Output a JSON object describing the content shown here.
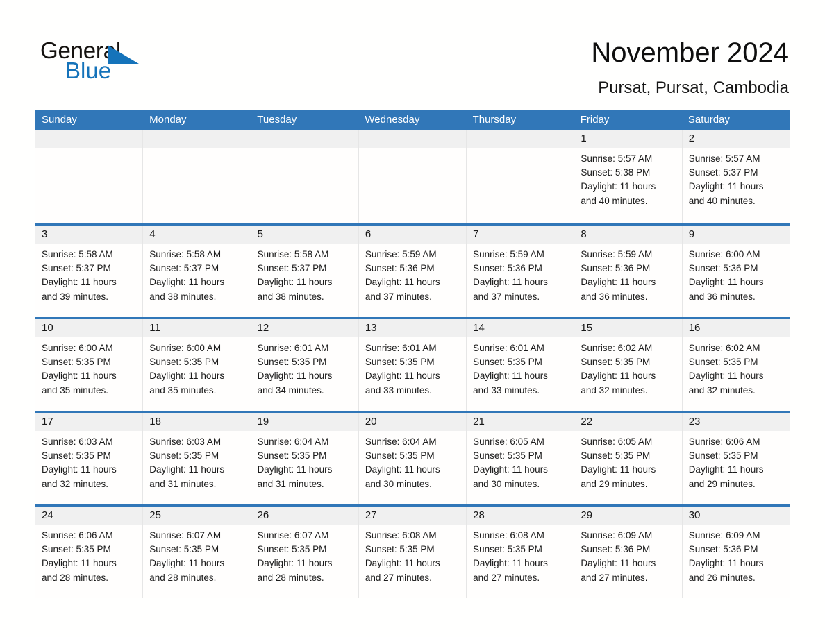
{
  "brand": {
    "name_part1": "General",
    "name_part2": "Blue",
    "accent_color": "#1573ba"
  },
  "header": {
    "title": "November 2024",
    "subtitle": "Pursat, Pursat, Cambodia"
  },
  "calendar": {
    "header_color": "#3177b8",
    "daynum_band_color": "#f0f0f0",
    "weekday_headers": [
      "Sunday",
      "Monday",
      "Tuesday",
      "Wednesday",
      "Thursday",
      "Friday",
      "Saturday"
    ],
    "weeks": [
      [
        {
          "day": "",
          "lines": []
        },
        {
          "day": "",
          "lines": []
        },
        {
          "day": "",
          "lines": []
        },
        {
          "day": "",
          "lines": []
        },
        {
          "day": "",
          "lines": []
        },
        {
          "day": "1",
          "lines": [
            "Sunrise: 5:57 AM",
            "Sunset: 5:38 PM",
            "Daylight: 11 hours",
            "and 40 minutes."
          ]
        },
        {
          "day": "2",
          "lines": [
            "Sunrise: 5:57 AM",
            "Sunset: 5:37 PM",
            "Daylight: 11 hours",
            "and 40 minutes."
          ]
        }
      ],
      [
        {
          "day": "3",
          "lines": [
            "Sunrise: 5:58 AM",
            "Sunset: 5:37 PM",
            "Daylight: 11 hours",
            "and 39 minutes."
          ]
        },
        {
          "day": "4",
          "lines": [
            "Sunrise: 5:58 AM",
            "Sunset: 5:37 PM",
            "Daylight: 11 hours",
            "and 38 minutes."
          ]
        },
        {
          "day": "5",
          "lines": [
            "Sunrise: 5:58 AM",
            "Sunset: 5:37 PM",
            "Daylight: 11 hours",
            "and 38 minutes."
          ]
        },
        {
          "day": "6",
          "lines": [
            "Sunrise: 5:59 AM",
            "Sunset: 5:36 PM",
            "Daylight: 11 hours",
            "and 37 minutes."
          ]
        },
        {
          "day": "7",
          "lines": [
            "Sunrise: 5:59 AM",
            "Sunset: 5:36 PM",
            "Daylight: 11 hours",
            "and 37 minutes."
          ]
        },
        {
          "day": "8",
          "lines": [
            "Sunrise: 5:59 AM",
            "Sunset: 5:36 PM",
            "Daylight: 11 hours",
            "and 36 minutes."
          ]
        },
        {
          "day": "9",
          "lines": [
            "Sunrise: 6:00 AM",
            "Sunset: 5:36 PM",
            "Daylight: 11 hours",
            "and 36 minutes."
          ]
        }
      ],
      [
        {
          "day": "10",
          "lines": [
            "Sunrise: 6:00 AM",
            "Sunset: 5:35 PM",
            "Daylight: 11 hours",
            "and 35 minutes."
          ]
        },
        {
          "day": "11",
          "lines": [
            "Sunrise: 6:00 AM",
            "Sunset: 5:35 PM",
            "Daylight: 11 hours",
            "and 35 minutes."
          ]
        },
        {
          "day": "12",
          "lines": [
            "Sunrise: 6:01 AM",
            "Sunset: 5:35 PM",
            "Daylight: 11 hours",
            "and 34 minutes."
          ]
        },
        {
          "day": "13",
          "lines": [
            "Sunrise: 6:01 AM",
            "Sunset: 5:35 PM",
            "Daylight: 11 hours",
            "and 33 minutes."
          ]
        },
        {
          "day": "14",
          "lines": [
            "Sunrise: 6:01 AM",
            "Sunset: 5:35 PM",
            "Daylight: 11 hours",
            "and 33 minutes."
          ]
        },
        {
          "day": "15",
          "lines": [
            "Sunrise: 6:02 AM",
            "Sunset: 5:35 PM",
            "Daylight: 11 hours",
            "and 32 minutes."
          ]
        },
        {
          "day": "16",
          "lines": [
            "Sunrise: 6:02 AM",
            "Sunset: 5:35 PM",
            "Daylight: 11 hours",
            "and 32 minutes."
          ]
        }
      ],
      [
        {
          "day": "17",
          "lines": [
            "Sunrise: 6:03 AM",
            "Sunset: 5:35 PM",
            "Daylight: 11 hours",
            "and 32 minutes."
          ]
        },
        {
          "day": "18",
          "lines": [
            "Sunrise: 6:03 AM",
            "Sunset: 5:35 PM",
            "Daylight: 11 hours",
            "and 31 minutes."
          ]
        },
        {
          "day": "19",
          "lines": [
            "Sunrise: 6:04 AM",
            "Sunset: 5:35 PM",
            "Daylight: 11 hours",
            "and 31 minutes."
          ]
        },
        {
          "day": "20",
          "lines": [
            "Sunrise: 6:04 AM",
            "Sunset: 5:35 PM",
            "Daylight: 11 hours",
            "and 30 minutes."
          ]
        },
        {
          "day": "21",
          "lines": [
            "Sunrise: 6:05 AM",
            "Sunset: 5:35 PM",
            "Daylight: 11 hours",
            "and 30 minutes."
          ]
        },
        {
          "day": "22",
          "lines": [
            "Sunrise: 6:05 AM",
            "Sunset: 5:35 PM",
            "Daylight: 11 hours",
            "and 29 minutes."
          ]
        },
        {
          "day": "23",
          "lines": [
            "Sunrise: 6:06 AM",
            "Sunset: 5:35 PM",
            "Daylight: 11 hours",
            "and 29 minutes."
          ]
        }
      ],
      [
        {
          "day": "24",
          "lines": [
            "Sunrise: 6:06 AM",
            "Sunset: 5:35 PM",
            "Daylight: 11 hours",
            "and 28 minutes."
          ]
        },
        {
          "day": "25",
          "lines": [
            "Sunrise: 6:07 AM",
            "Sunset: 5:35 PM",
            "Daylight: 11 hours",
            "and 28 minutes."
          ]
        },
        {
          "day": "26",
          "lines": [
            "Sunrise: 6:07 AM",
            "Sunset: 5:35 PM",
            "Daylight: 11 hours",
            "and 28 minutes."
          ]
        },
        {
          "day": "27",
          "lines": [
            "Sunrise: 6:08 AM",
            "Sunset: 5:35 PM",
            "Daylight: 11 hours",
            "and 27 minutes."
          ]
        },
        {
          "day": "28",
          "lines": [
            "Sunrise: 6:08 AM",
            "Sunset: 5:35 PM",
            "Daylight: 11 hours",
            "and 27 minutes."
          ]
        },
        {
          "day": "29",
          "lines": [
            "Sunrise: 6:09 AM",
            "Sunset: 5:36 PM",
            "Daylight: 11 hours",
            "and 27 minutes."
          ]
        },
        {
          "day": "30",
          "lines": [
            "Sunrise: 6:09 AM",
            "Sunset: 5:36 PM",
            "Daylight: 11 hours",
            "and 26 minutes."
          ]
        }
      ]
    ]
  }
}
